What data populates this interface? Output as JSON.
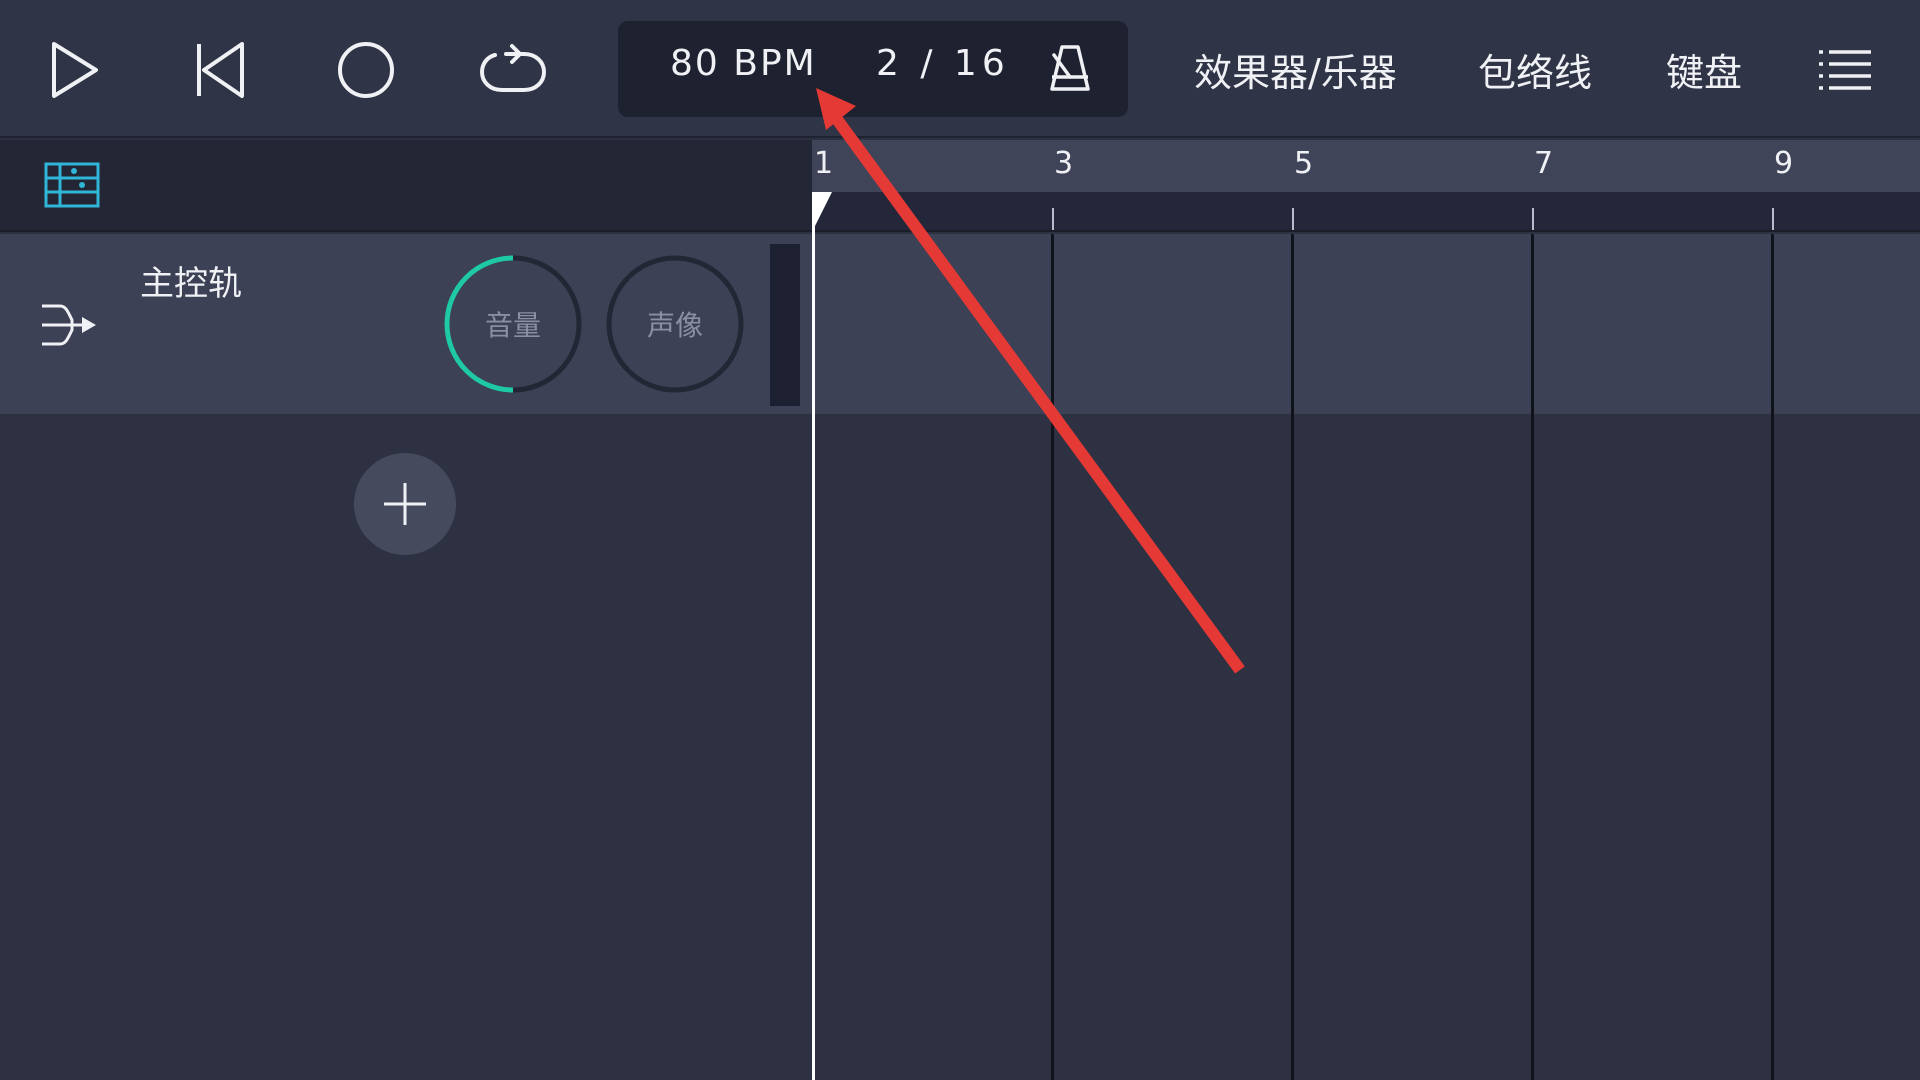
{
  "toolbar": {
    "play_icon": "play-icon",
    "rewind_icon": "skip-to-start-icon",
    "record_icon": "record-icon",
    "loop_icon": "loop-icon",
    "tempo": "80 BPM",
    "time_signature": "2 / 16",
    "metronome_icon": "metronome-icon",
    "fx_instruments": "效果器/乐器",
    "envelope": "包络线",
    "keyboard": "键盘",
    "menu_icon": "hamburger-menu-icon"
  },
  "tracks": {
    "mixer_icon": "mixer-icon",
    "master": {
      "name": "主控轨",
      "route_icon": "routing-arrow-icon",
      "volume_label": "音量",
      "volume_level": 0.5,
      "pan_label": "声像"
    },
    "add_track_icon": "plus-icon"
  },
  "timeline": {
    "bar_numbers": [
      "1",
      "3",
      "5",
      "7",
      "9"
    ]
  },
  "colors": {
    "accent": "#1fc9a5",
    "background": "#2d3142",
    "track_lane": "#3c4155",
    "annotation_arrow": "#e53935"
  }
}
